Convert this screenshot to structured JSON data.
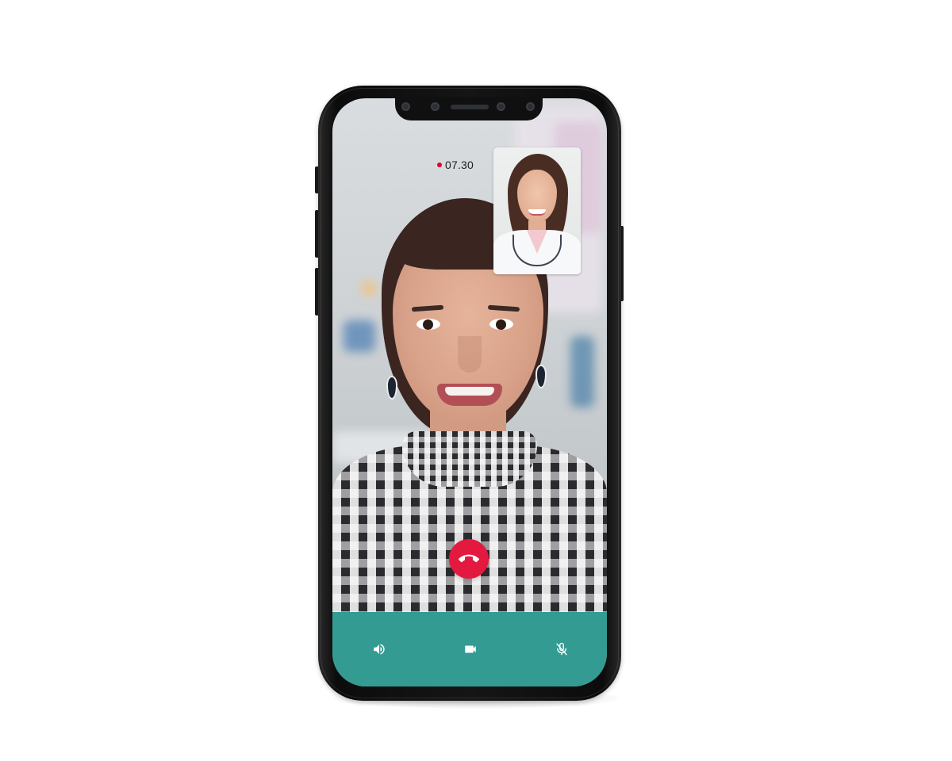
{
  "call": {
    "timer": "07.30",
    "recording": true,
    "caller_name": "",
    "self_view": true
  },
  "controls": {
    "end_call_icon": "phone-hangup-icon",
    "speaker_icon": "speaker-icon",
    "video_icon": "video-camera-icon",
    "mute_icon": "microphone-off-icon"
  },
  "colors": {
    "control_bar": "#339b92",
    "end_call": "#e3193f",
    "recording_dot": "#e4002b"
  }
}
